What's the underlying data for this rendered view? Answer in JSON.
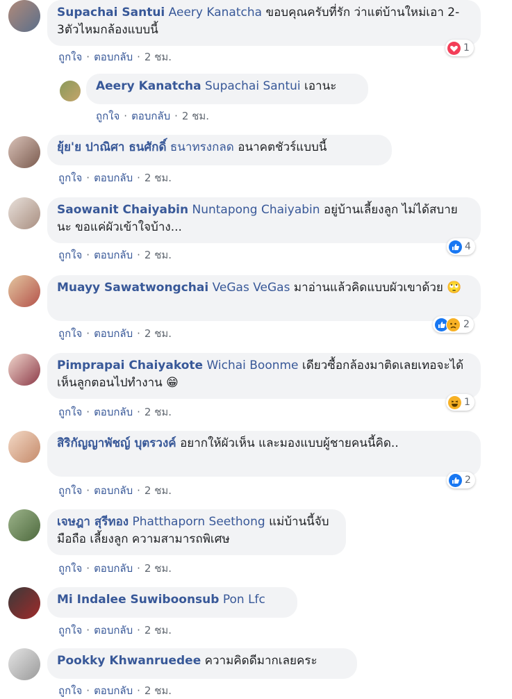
{
  "comments": [
    {
      "author": "Supachai Santui",
      "mention": "Aeery Kanatcha",
      "text": " ขอบคุณครับที่รัก ว่าแต่บ้านใหม่เอา 2-3ตัวไหมกล้องแบบนี้",
      "like": "ถูกใจ",
      "reply": "ตอบกลับ",
      "time": "2 ชม.",
      "reaction": {
        "type": "heart",
        "count": "1"
      }
    },
    {
      "author": "Aeery Kanatcha",
      "mention": "Supachai Santui",
      "text": " เอานะ",
      "like": "ถูกใจ",
      "reply": "ตอบกลับ",
      "time": "2 ชม."
    },
    {
      "author": "ยุ้ย'ย ปาณิศา ธนศักดิ์",
      "mention": "ธนาทรงกลด",
      "text": " อนาคตชัวร์แบบนี้",
      "like": "ถูกใจ",
      "reply": "ตอบกลับ",
      "time": "2 ชม."
    },
    {
      "author": "Saowanit Chaiyabin",
      "mention": "Nuntapong Chaiyabin",
      "text": " อยู่บ้านเลี้ยงลูก ไม่ได้สบายนะ ขอแค่ผัวเข้าใจบ้าง...",
      "like": "ถูกใจ",
      "reply": "ตอบกลับ",
      "time": "2 ชม.",
      "reaction": {
        "type": "like",
        "count": "4"
      }
    },
    {
      "author": "Muayy Sawatwongchai",
      "mention": "VeGas VeGas",
      "text": " มาอ่านแล้วคิดแบบผัวเขาด้วย 🙄",
      "like": "ถูกใจ",
      "reply": "ตอบกลับ",
      "time": "2 ชม.",
      "reaction": {
        "type": "like-sad",
        "count": "2"
      }
    },
    {
      "author": "Pimprapai Chaiyakote",
      "mention": "Wichai Boonme",
      "text": " เดียวซื้อกล้องมาติดเลยเทอจะได้เห็นลูกตอนไปทำงาน 😁",
      "like": "ถูกใจ",
      "reply": "ตอบกลับ",
      "time": "2 ชม.",
      "reaction": {
        "type": "haha",
        "count": "1"
      }
    },
    {
      "author": "สิริกัญญาพัชญ์ บุตรวงค์",
      "mention": "",
      "text": "อยากให้ผัวเห็น และมองแบบผู้ชายคนนี้คิด..",
      "like": "ถูกใจ",
      "reply": "ตอบกลับ",
      "time": "2 ชม.",
      "reaction": {
        "type": "like",
        "count": "2"
      }
    },
    {
      "author": "เจษฎา สุรีทอง",
      "mention": "Phatthaporn Seethong",
      "text": "แม่บ้านนี้จับมือถือ เลี้ยงลูก ความสามารถพิเศษ",
      "like": "ถูกใจ",
      "reply": "ตอบกลับ",
      "time": "2 ชม."
    },
    {
      "author": "Mi Indalee Suwiboonsub",
      "mention": "Pon Lfc",
      "text": "",
      "like": "ถูกใจ",
      "reply": "ตอบกลับ",
      "time": "2 ชม."
    },
    {
      "author": "Pookky Khwanruedee",
      "mention": "",
      "text": " ความคิดดีมากเลยคระ",
      "like": "ถูกใจ",
      "reply": "ตอบกลับ",
      "time": "2 ชม."
    }
  ],
  "colors": {
    "link": "#385898",
    "bubble": "#f2f3f5",
    "meta": "#606770",
    "like": "#1877f2",
    "heart": "#f33e58",
    "haha": "#f7b125"
  }
}
